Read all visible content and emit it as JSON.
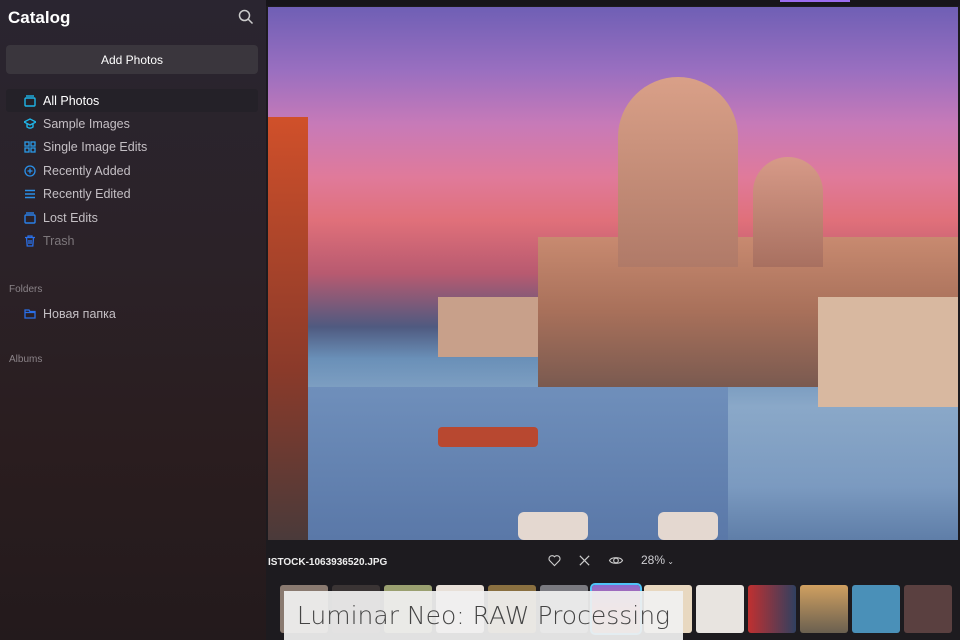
{
  "sidebar": {
    "title": "Catalog",
    "add_photos": "Add Photos",
    "items": [
      {
        "label": "All Photos",
        "icon": "photos-icon"
      },
      {
        "label": "Sample Images",
        "icon": "graduation-cap-icon"
      },
      {
        "label": "Single Image Edits",
        "icon": "grid-icon"
      },
      {
        "label": "Recently Added",
        "icon": "plus-circle-icon"
      },
      {
        "label": "Recently Edited",
        "icon": "sliders-icon"
      },
      {
        "label": "Lost Edits",
        "icon": "photos-icon"
      },
      {
        "label": "Trash",
        "icon": "trash-icon"
      }
    ],
    "folders_label": "Folders",
    "folder": "Новая папка",
    "albums_label": "Albums"
  },
  "viewer": {
    "filename": "ISTOCK-1063936520.JPG",
    "zoom": "28%"
  },
  "caption": "Luminar Neo: RAW Processing",
  "colors": {
    "accent": "#1fb6e8",
    "selected": "#4fc3f7"
  }
}
